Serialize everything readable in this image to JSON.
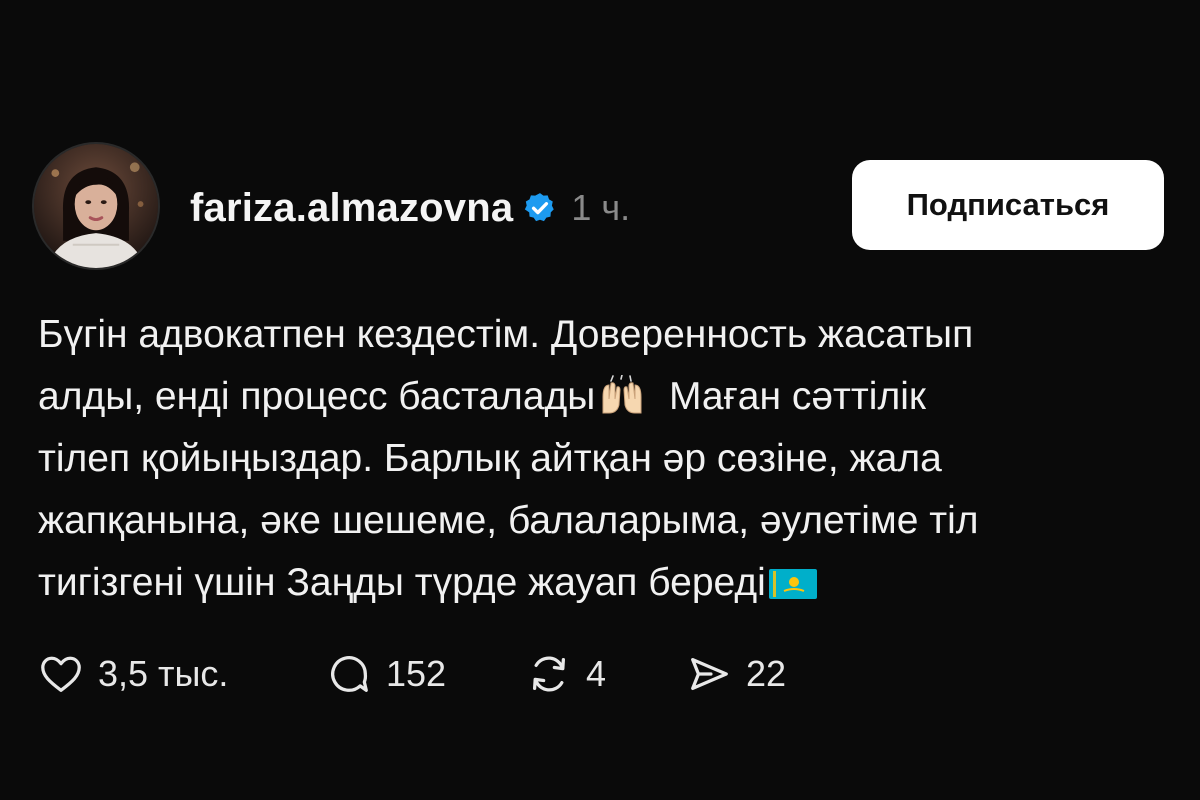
{
  "post": {
    "author": {
      "username": "fariza.almazovna",
      "verified": true,
      "time": "1 ч."
    },
    "follow_label": "Подписаться",
    "text_lines": [
      "Бүгін адвокатпен кездестім. Доверенность жасатып",
      "алды, енді процесс басталады",
      "Маған сәттілік",
      "тілеп қойыңыздар. Барлық айтқан әр сөзіне, жала",
      "жапқанына, әке шешеме, балаларыма, әулетіме тіл",
      "тигізгені үшін Заңды түрде жауап береді"
    ],
    "emojis": [
      "raising-hands-emoji",
      "kazakhstan-flag-emoji"
    ],
    "actions": {
      "likes": "3,5 тыс.",
      "comments": "152",
      "reposts": "4",
      "shares": "22"
    },
    "colors": {
      "background": "#0a0a0a",
      "text": "#f1f1f1",
      "muted": "#8a8a8a",
      "verified_blue": "#1d9bf0",
      "button_bg": "#ffffff"
    }
  }
}
